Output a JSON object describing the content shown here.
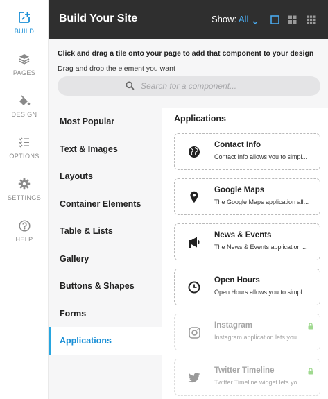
{
  "nav": {
    "items": [
      {
        "label": "BUILD",
        "icon": "build-icon",
        "active": true
      },
      {
        "label": "PAGES",
        "icon": "pages-icon",
        "active": false
      },
      {
        "label": "DESIGN",
        "icon": "design-icon",
        "active": false
      },
      {
        "label": "OPTIONS",
        "icon": "options-icon",
        "active": false
      },
      {
        "label": "SETTINGS",
        "icon": "settings-icon",
        "active": false
      },
      {
        "label": "HELP",
        "icon": "help-icon",
        "active": false
      }
    ]
  },
  "header": {
    "title": "Build Your Site",
    "show_label": "Show:",
    "show_value": "All"
  },
  "instructions": {
    "line1": "Click and drag a tile onto your page to add that component to your design",
    "line2": "Drag and drop the element you want"
  },
  "search": {
    "placeholder": "Search for a component...",
    "value": ""
  },
  "categories": [
    {
      "label": "Most Popular",
      "active": false
    },
    {
      "label": "Text & Images",
      "active": false
    },
    {
      "label": "Layouts",
      "active": false
    },
    {
      "label": "Container Elements",
      "active": false
    },
    {
      "label": "Table & Lists",
      "active": false
    },
    {
      "label": "Gallery",
      "active": false
    },
    {
      "label": "Buttons & Shapes",
      "active": false
    },
    {
      "label": "Forms",
      "active": false
    },
    {
      "label": "Applications",
      "active": true
    }
  ],
  "panel": {
    "title": "Applications",
    "tiles": [
      {
        "name": "Contact Info",
        "desc": "Contact Info allows you to simpl...",
        "icon": "globe-icon",
        "locked": false
      },
      {
        "name": "Google Maps",
        "desc": "The Google Maps application all...",
        "icon": "map-pin-icon",
        "locked": false
      },
      {
        "name": "News & Events",
        "desc": "The News & Events application ...",
        "icon": "megaphone-icon",
        "locked": false
      },
      {
        "name": "Open Hours",
        "desc": "Open Hours allows you to simpl...",
        "icon": "clock-icon",
        "locked": false
      },
      {
        "name": "Instagram",
        "desc": "Instagram application lets you ...",
        "icon": "instagram-icon",
        "locked": true
      },
      {
        "name": "Twitter Timeline",
        "desc": "Twitter Timeline widget lets yo...",
        "icon": "twitter-icon",
        "locked": true
      }
    ]
  },
  "colors": {
    "accent": "#1a8fd6",
    "header_bg": "#2f2f2f",
    "sidebar_bg": "#f6f6f7"
  }
}
